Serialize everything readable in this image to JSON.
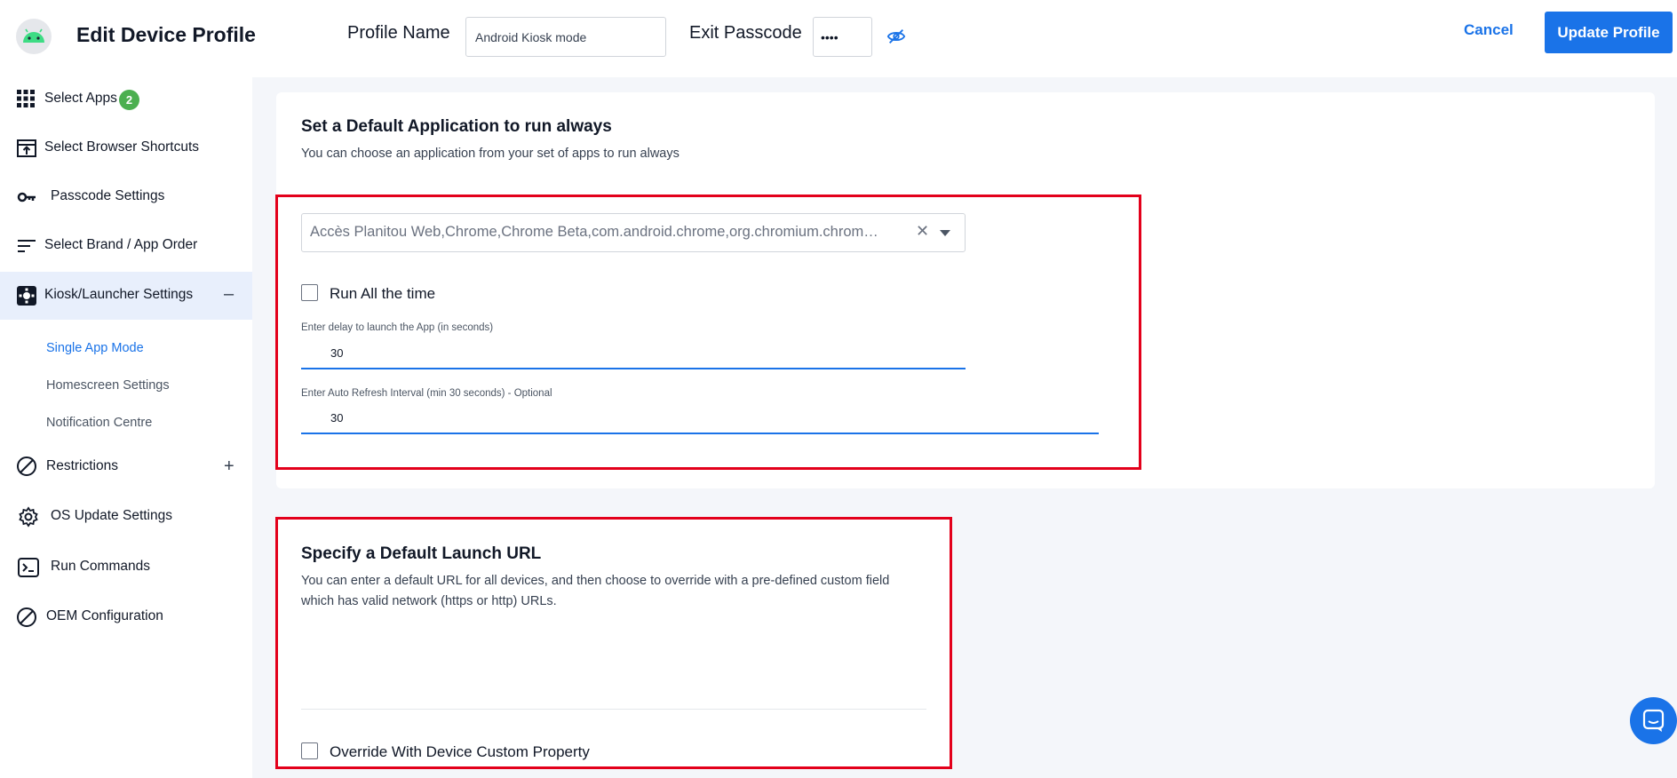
{
  "header": {
    "title": "Edit Device Profile",
    "profile_name_label": "Profile Name",
    "profile_name_value": "Android Kiosk mode",
    "exit_passcode_label": "Exit Passcode",
    "exit_passcode_value": "••••",
    "cancel_label": "Cancel",
    "update_label": "Update Profile"
  },
  "sidebar": {
    "items": [
      {
        "label": "Select Apps",
        "badge": "2",
        "icon": "grid-icon"
      },
      {
        "label": "Select Browser Shortcuts",
        "icon": "shortcut-icon"
      },
      {
        "label": "Passcode Settings",
        "icon": "key-icon"
      },
      {
        "label": "Select Brand / App Order",
        "icon": "sort-icon"
      },
      {
        "label": "Kiosk/Launcher Settings",
        "icon": "kiosk-icon",
        "toggle": "–"
      },
      {
        "label": "Restrictions",
        "icon": "block-icon",
        "toggle": "+"
      },
      {
        "label": "OS Update Settings",
        "icon": "gear-icon"
      },
      {
        "label": "Run Commands",
        "icon": "terminal-icon"
      },
      {
        "label": "OEM Configuration",
        "icon": "block-icon"
      }
    ],
    "subitems": [
      "Single App Mode",
      "Homescreen Settings",
      "Notification Centre"
    ]
  },
  "section1": {
    "title": "Set a Default Application to run always",
    "description": "You can choose an application from your set of apps to run always",
    "selected_apps": "Accès Planitou Web,Chrome,Chrome Beta,com.android.chrome,org.chromium.chrom…",
    "run_all_label": "Run All the time",
    "delay_label": "Enter delay to launch the App (in seconds)",
    "delay_value": "30",
    "refresh_label": "Enter Auto Refresh Interval (min 30 seconds) - Optional",
    "refresh_value": "30"
  },
  "section2": {
    "title": "Specify a Default Launch URL",
    "description_line1": "You can enter a default URL for all devices, and then choose to override with a pre-defined custom field",
    "description_line2": "which has valid network (https or http) URLs.",
    "override_label": "Override With Device Custom Property"
  },
  "colors": {
    "accent": "#1a73e8",
    "badge": "#4caf50",
    "highlight_box": "#e3001b",
    "active_nav_bg": "#e8effc"
  }
}
